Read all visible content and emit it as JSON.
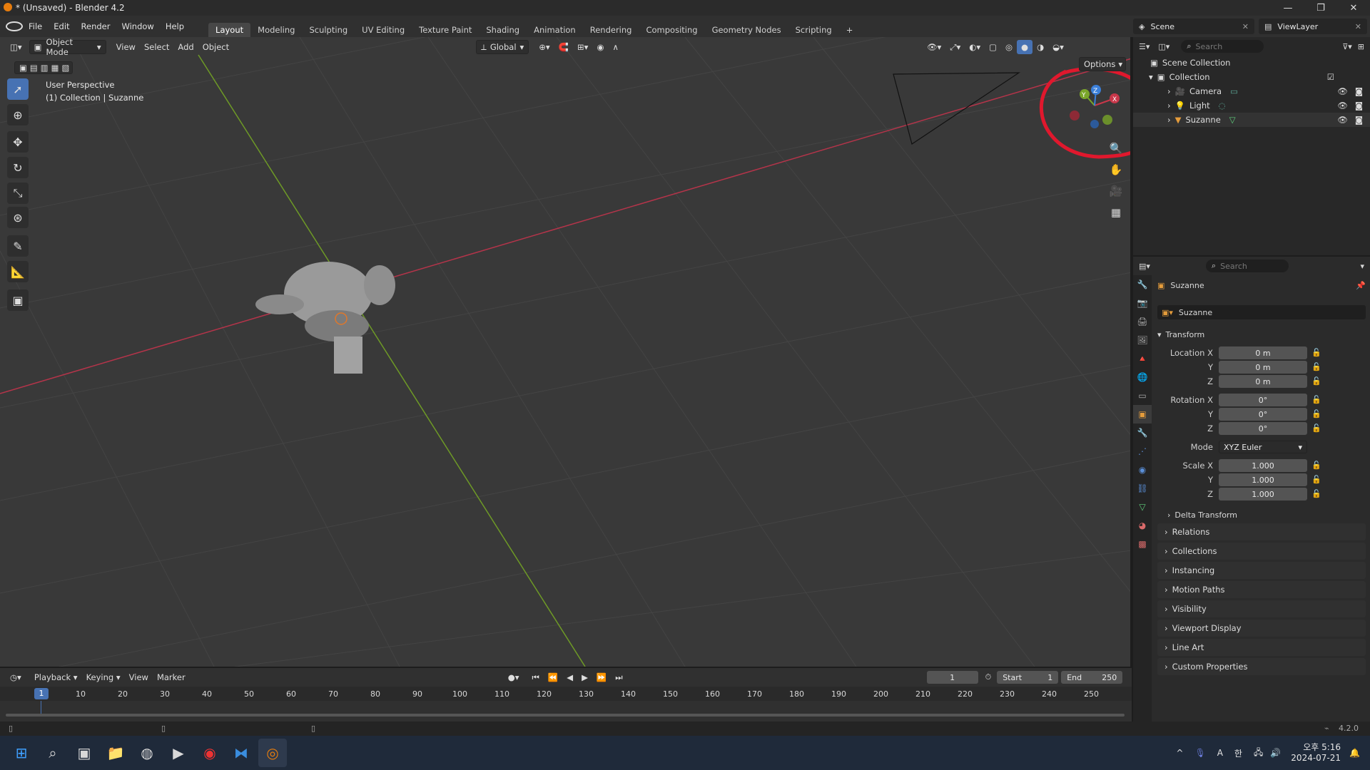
{
  "window": {
    "title": "* (Unsaved) - Blender 4.2"
  },
  "menus": [
    "File",
    "Edit",
    "Render",
    "Window",
    "Help"
  ],
  "workspaces": [
    "Layout",
    "Modeling",
    "Sculpting",
    "UV Editing",
    "Texture Paint",
    "Shading",
    "Animation",
    "Rendering",
    "Compositing",
    "Geometry Nodes",
    "Scripting"
  ],
  "active_workspace": "Layout",
  "scene": {
    "name": "Scene",
    "view_layer": "ViewLayer"
  },
  "viewport": {
    "mode": "Object Mode",
    "menus": [
      "View",
      "Select",
      "Add",
      "Object"
    ],
    "orientation": "Global",
    "options_label": "Options",
    "info_line1": "User Perspective",
    "info_line2": "(1) Collection | Suzanne",
    "gizmo_axes": [
      "X",
      "Y",
      "Z"
    ]
  },
  "outliner": {
    "search_placeholder": "Search",
    "scene_collection": "Scene Collection",
    "collection": "Collection",
    "items": [
      "Camera",
      "Light",
      "Suzanne"
    ]
  },
  "properties": {
    "search_placeholder": "Search",
    "object_name": "Suzanne",
    "data_name": "Suzanne",
    "transform_label": "Transform",
    "location_labels": [
      "Location X",
      "Y",
      "Z"
    ],
    "location_values": [
      "0 m",
      "0 m",
      "0 m"
    ],
    "rotation_labels": [
      "Rotation X",
      "Y",
      "Z"
    ],
    "rotation_values": [
      "0°",
      "0°",
      "0°"
    ],
    "mode_label": "Mode",
    "mode_value": "XYZ Euler",
    "scale_labels": [
      "Scale X",
      "Y",
      "Z"
    ],
    "scale_values": [
      "1.000",
      "1.000",
      "1.000"
    ],
    "delta_transform": "Delta Transform",
    "panels": [
      "Relations",
      "Collections",
      "Instancing",
      "Motion Paths",
      "Visibility",
      "Viewport Display",
      "Line Art",
      "Custom Properties"
    ]
  },
  "timeline": {
    "menus": [
      "Playback",
      "Keying",
      "View",
      "Marker"
    ],
    "current_frame": "1",
    "start_label": "Start",
    "start_value": "1",
    "end_label": "End",
    "end_value": "250",
    "ruler": [
      "10",
      "20",
      "30",
      "40",
      "50",
      "60",
      "70",
      "80",
      "90",
      "100",
      "110",
      "120",
      "130",
      "140",
      "150",
      "160",
      "170",
      "180",
      "190",
      "200",
      "210",
      "220",
      "230",
      "240",
      "250"
    ]
  },
  "statusbar": {
    "version": "4.2.0"
  },
  "taskbar": {
    "time": "오후 5:16",
    "date": "2024-07-21",
    "ime_a": "A",
    "ime_han": "한"
  },
  "colors": {
    "accent": "#4772b3",
    "annotation": "#e0182d",
    "x_axis": "#c8374a",
    "y_axis": "#7aa62a",
    "z_axis": "#3b7fd9"
  }
}
